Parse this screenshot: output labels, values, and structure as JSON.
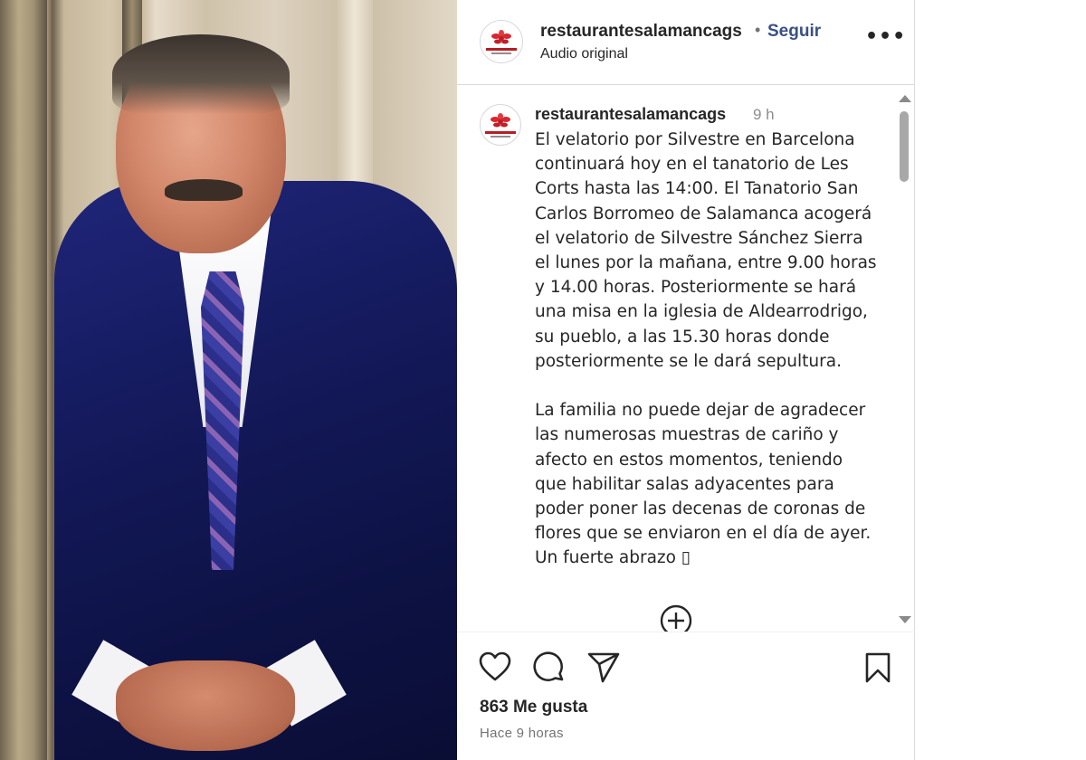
{
  "header": {
    "username": "restaurantesalamancags",
    "separator": "•",
    "follow_label": "Seguir",
    "subtitle": "Audio original",
    "more_icon": "more-horizontal-icon",
    "more_label": "•••"
  },
  "comment": {
    "username": "restaurantesalamancags",
    "time": "9 h",
    "text": "El velatorio por Silvestre en Barcelona\ncontinuará hoy en el tanatorio de Les\nCorts hasta las 14:00. El Tanatorio San\nCarlos Borromeo de Salamanca acogerá\nel velatorio de Silvestre Sánchez Sierra\nel lunes por la mañana, entre 9.00 horas\ny 14.00 horas. Posteriormente se hará\nuna misa en la iglesia de Aldearrodrigo,\nsu pueblo, a las 15.30 horas donde\nposteriormente se le dará sepultura.\n\nLa familia no puede dejar de agradecer\nlas numerosas muestras de cariño y\nafecto en estos momentos, teniendo\nque habilitar salas adyacentes para\npoder poner las decenas de coronas de\nflores que se enviaron en el día de ayer.\nUn fuerte abrazo ▯"
  },
  "actions": {
    "icons": [
      "heart-icon",
      "comment-icon",
      "share-icon",
      "bookmark-icon",
      "plus-circle-icon"
    ]
  },
  "stats": {
    "likes": "863 Me gusta",
    "posted": "Hace 9 horas"
  },
  "colors": {
    "follow": "#385185",
    "logo_red": "#b81d24",
    "border": "#dbdbdb"
  }
}
